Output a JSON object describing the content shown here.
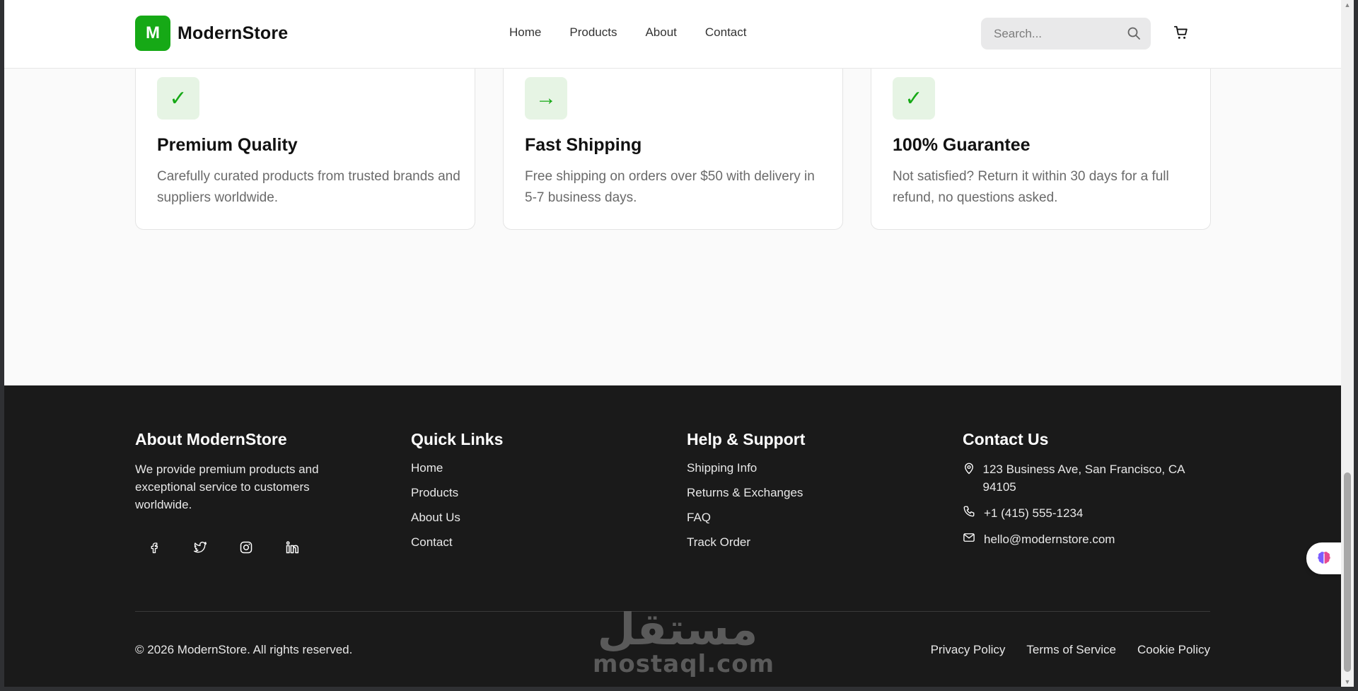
{
  "header": {
    "logo_letter": "M",
    "brand": "ModernStore",
    "nav": [
      "Home",
      "Products",
      "About",
      "Contact"
    ],
    "search_placeholder": "Search..."
  },
  "features": [
    {
      "icon": "check-icon",
      "glyph": "✓",
      "title": "Premium Quality",
      "desc": "Carefully curated products from trusted brands and suppliers worldwide."
    },
    {
      "icon": "arrow-right-icon",
      "glyph": "→",
      "title": "Fast Shipping",
      "desc": "Free shipping on orders over $50 with delivery in 5-7 business days."
    },
    {
      "icon": "check-icon",
      "glyph": "✓",
      "title": "100% Guarantee",
      "desc": "Not satisfied? Return it within 30 days for a full refund, no questions asked."
    }
  ],
  "footer": {
    "about": {
      "title": "About ModernStore",
      "text": "We provide premium products and exceptional service to customers worldwide.",
      "socials": [
        "facebook-icon",
        "twitter-icon",
        "instagram-icon",
        "linkedin-icon"
      ]
    },
    "quick_links": {
      "title": "Quick Links",
      "items": [
        "Home",
        "Products",
        "About Us",
        "Contact"
      ]
    },
    "help": {
      "title": "Help & Support",
      "items": [
        "Shipping Info",
        "Returns & Exchanges",
        "FAQ",
        "Track Order"
      ]
    },
    "contact": {
      "title": "Contact Us",
      "address": "123 Business Ave, San Francisco, CA 94105",
      "phone": "+1 (415) 555-1234",
      "email": "hello@modernstore.com"
    },
    "copyright": "© 2026 ModernStore. All rights reserved.",
    "legal": [
      "Privacy Policy",
      "Terms of Service",
      "Cookie Policy"
    ]
  },
  "watermark": {
    "arabic": "مستقل",
    "latin": "mostaql.com"
  },
  "colors": {
    "brand_green": "#16a916",
    "footer_bg": "#1a1a1a",
    "icon_bg": "#e6f4e4"
  }
}
